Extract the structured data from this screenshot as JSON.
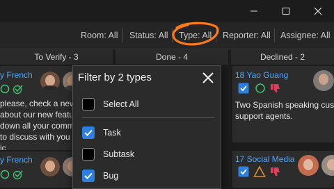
{
  "filters": {
    "room": "Room: All",
    "status": "Status: All",
    "type": "Type: All",
    "reporter": "Reporter: All",
    "assignee": "Assignee: All"
  },
  "columns": [
    {
      "title": "To Verify - 3"
    },
    {
      "title": "Done - 4"
    },
    {
      "title": "Declined - 2"
    }
  ],
  "cards": {
    "to_verify_1": {
      "title": "y French",
      "lines": [
        "please, check a new",
        "about our new featu",
        "down all your comm",
        "to discuss with you",
        "ic"
      ]
    },
    "to_verify_2": {
      "title": "y French"
    },
    "declined_1": {
      "title": "18 Yao Guang",
      "lines": [
        "Two Spanish speaking cust",
        "support agents."
      ]
    },
    "declined_2": {
      "title": "17 Social Media"
    }
  },
  "dropdown": {
    "title": "Filter by 2 types",
    "select_all": "Select All",
    "items": [
      {
        "label": "Task",
        "checked": true
      },
      {
        "label": "Subtask",
        "checked": false
      },
      {
        "label": "Bug",
        "checked": true
      }
    ]
  },
  "colors": {
    "accent": "#2f7fe0",
    "link": "#4fa6ff",
    "annotation": "#ff7a1a",
    "success": "#3fbf6f",
    "warning": "#e08a2e",
    "danger": "#d9415a"
  }
}
